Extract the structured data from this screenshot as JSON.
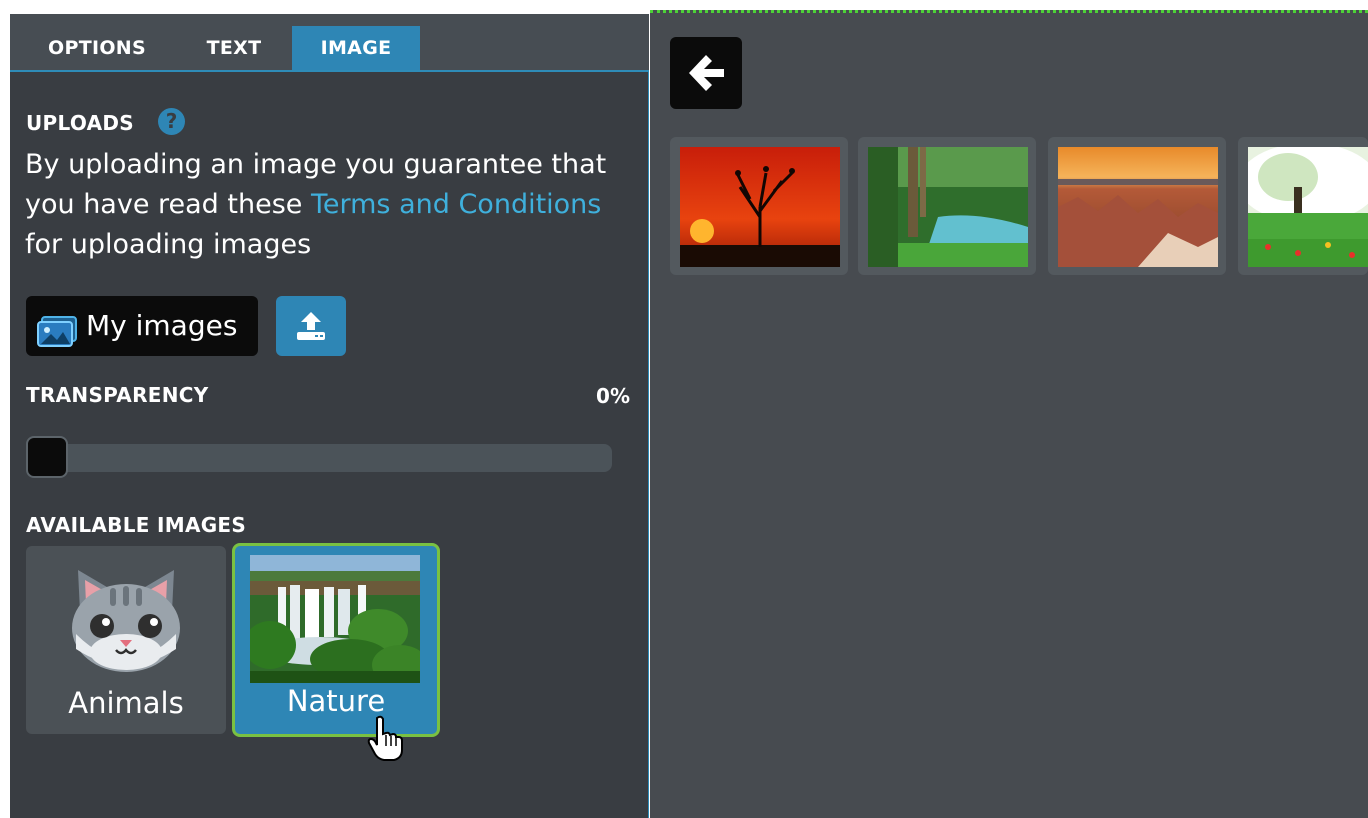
{
  "tabs": [
    {
      "label": "OPTIONS",
      "active": false
    },
    {
      "label": "TEXT",
      "active": false
    },
    {
      "label": "IMAGE",
      "active": true
    }
  ],
  "uploads": {
    "title": "UPLOADS",
    "help_glyph": "?",
    "desc_before": "By uploading an image you guarantee that you have read these ",
    "desc_link": "Terms and Conditions",
    "desc_after": " for uploading images",
    "my_images_label": "My images",
    "upload_icon": "upload-icon"
  },
  "transparency": {
    "title": "TRANSPARENCY",
    "value_label": "0%",
    "value": 0
  },
  "available_images": {
    "title": "AVAILABLE IMAGES",
    "categories": [
      {
        "label": "Animals",
        "icon": "cat-icon",
        "selected": false
      },
      {
        "label": "Nature",
        "icon": "waterfall-image",
        "selected": true
      }
    ]
  },
  "gallery": {
    "back_icon": "arrow-left-icon",
    "images": [
      {
        "name": "sunset-tree-image"
      },
      {
        "name": "forest-river-image"
      },
      {
        "name": "canyon-image"
      },
      {
        "name": "blossom-meadow-image"
      }
    ]
  },
  "colors": {
    "accent": "#2e86b5",
    "selected_border": "#7ac142",
    "link": "#3fb0dc",
    "panel_bg": "#393d42",
    "right_bg": "#474b50"
  }
}
